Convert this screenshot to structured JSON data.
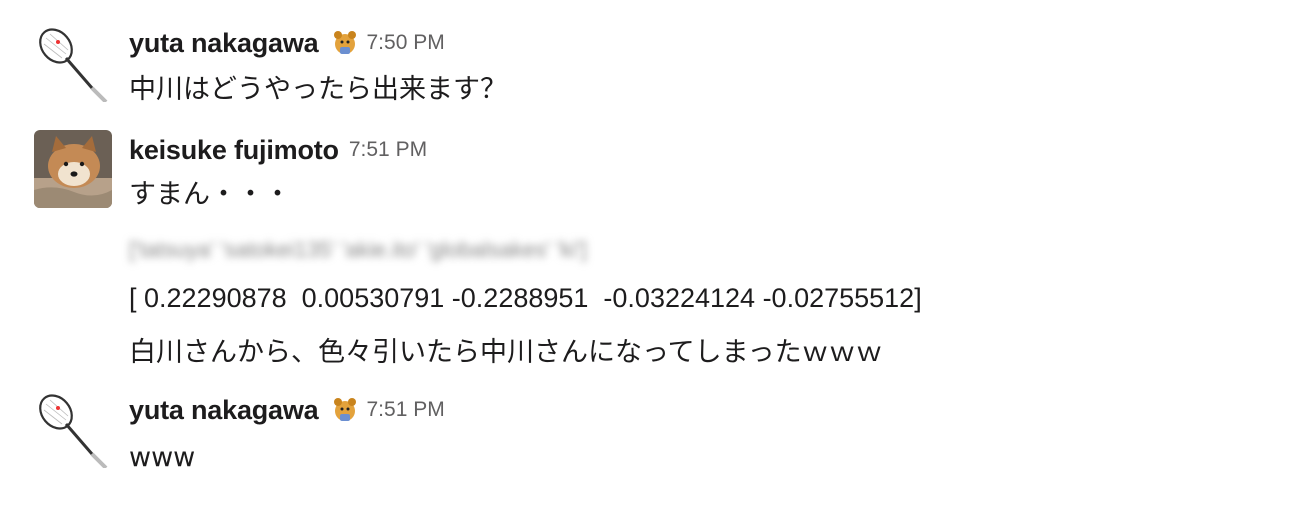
{
  "messages": [
    {
      "sender": "yuta nakagawa",
      "time": "7:50 PM",
      "avatar_icon": "tennis-racket-icon",
      "status_emoji": "bear-emoji-icon",
      "lines": [
        "中川はどうやったら出来ます？"
      ]
    },
    {
      "sender": "keisuke fujimoto",
      "time": "7:51 PM",
      "avatar_icon": "dog-photo-avatar",
      "lines": [
        "すまん・・・",
        "['tatsuya' 'satokei135' 'akie.ito' 'globalsakes' 'ki']",
        "[ 0.22290878  0.00530791 -0.2288951  -0.03224124 -0.02755512]",
        "白川さんから、色々引いたら中川さんになってしまったｗｗｗ"
      ]
    },
    {
      "sender": "yuta nakagawa",
      "time": "7:51 PM",
      "avatar_icon": "tennis-racket-icon",
      "status_emoji": "bear-emoji-icon",
      "lines": [
        "www"
      ]
    }
  ]
}
